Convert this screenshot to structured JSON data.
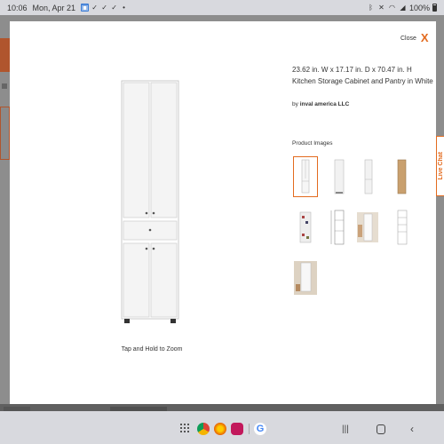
{
  "status_bar": {
    "time": "10:06",
    "date": "Mon, Apr 21",
    "battery_text": "100%",
    "left_icons": [
      "photo-icon",
      "check-icon",
      "check-icon",
      "check-icon",
      "dot-icon"
    ],
    "right_icons": [
      "bluetooth-icon",
      "mute-icon",
      "wifi-icon",
      "signal-icon",
      "battery-icon"
    ]
  },
  "live_chat": {
    "label": "Live Chat"
  },
  "modal": {
    "close_label": "Close",
    "title": "23.62 in. W x 17.17 in. D x 70.47 in. H Kitchen Storage Cabinet and Pantry in White",
    "by_prefix": "by",
    "brand": "inval america LLC",
    "images_heading": "Product Images",
    "zoom_hint": "Tap and Hold to Zoom",
    "thumbnails": [
      {
        "name": "thumbnail-1-white-cabinet-front",
        "selected": true
      },
      {
        "name": "thumbnail-2-white-cabinet-angle",
        "selected": false
      },
      {
        "name": "thumbnail-3-white-cabinet-side",
        "selected": false
      },
      {
        "name": "thumbnail-4-oak-cabinet",
        "selected": false
      },
      {
        "name": "thumbnail-5-open-cabinet",
        "selected": false
      },
      {
        "name": "thumbnail-6-dimension-diagram",
        "selected": false
      },
      {
        "name": "thumbnail-7-room-scene",
        "selected": false
      },
      {
        "name": "thumbnail-8-open-shelves",
        "selected": false
      },
      {
        "name": "thumbnail-9-room-scene-open",
        "selected": false
      }
    ]
  },
  "nav_bar": {
    "apps": [
      "app-drawer-icon",
      "chrome-icon",
      "firefox-icon",
      "media-app-icon",
      "google-icon"
    ],
    "buttons": [
      "recents-button",
      "home-button",
      "back-button"
    ]
  },
  "colors": {
    "accent": "#e36b1f",
    "status_bar": "#d8d9de",
    "overlay": "#7b7b7b"
  }
}
